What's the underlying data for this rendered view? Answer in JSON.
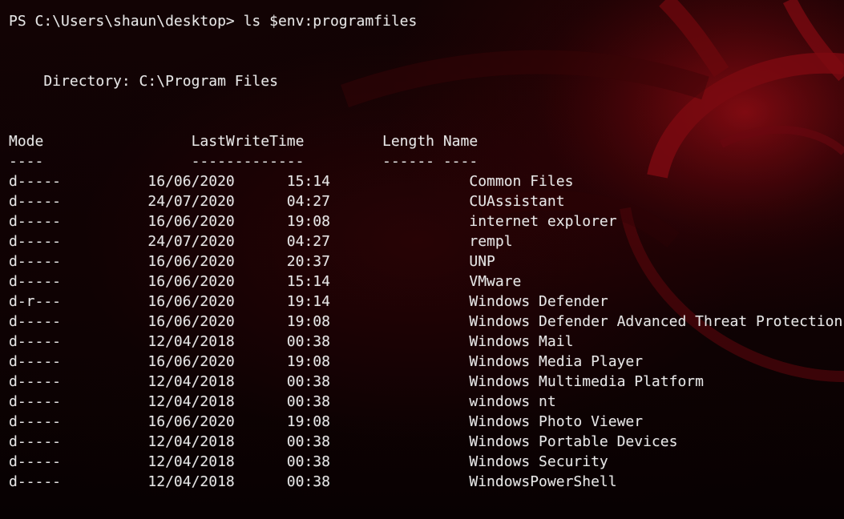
{
  "prompt": {
    "text": "PS C:\\Users\\shaun\\desktop> ls $env:programfiles"
  },
  "directory_line": "    Directory: C:\\Program Files",
  "listing": {
    "header_line": "Mode                 LastWriteTime         Length Name",
    "underline_line": "----                 -------------         ------ ----",
    "columns": [
      "Mode",
      "LastWriteTime",
      "Length",
      "Name"
    ],
    "rows": [
      {
        "mode": "d-----",
        "date": "16/06/2020",
        "time": "15:14",
        "length": "",
        "name": "Common Files"
      },
      {
        "mode": "d-----",
        "date": "24/07/2020",
        "time": "04:27",
        "length": "",
        "name": "CUAssistant"
      },
      {
        "mode": "d-----",
        "date": "16/06/2020",
        "time": "19:08",
        "length": "",
        "name": "internet explorer"
      },
      {
        "mode": "d-----",
        "date": "24/07/2020",
        "time": "04:27",
        "length": "",
        "name": "rempl"
      },
      {
        "mode": "d-----",
        "date": "16/06/2020",
        "time": "20:37",
        "length": "",
        "name": "UNP"
      },
      {
        "mode": "d-----",
        "date": "16/06/2020",
        "time": "15:14",
        "length": "",
        "name": "VMware"
      },
      {
        "mode": "d-r---",
        "date": "16/06/2020",
        "time": "19:14",
        "length": "",
        "name": "Windows Defender"
      },
      {
        "mode": "d-----",
        "date": "16/06/2020",
        "time": "19:08",
        "length": "",
        "name": "Windows Defender Advanced Threat Protection"
      },
      {
        "mode": "d-----",
        "date": "12/04/2018",
        "time": "00:38",
        "length": "",
        "name": "Windows Mail"
      },
      {
        "mode": "d-----",
        "date": "16/06/2020",
        "time": "19:08",
        "length": "",
        "name": "Windows Media Player"
      },
      {
        "mode": "d-----",
        "date": "12/04/2018",
        "time": "00:38",
        "length": "",
        "name": "Windows Multimedia Platform"
      },
      {
        "mode": "d-----",
        "date": "12/04/2018",
        "time": "00:38",
        "length": "",
        "name": "windows nt"
      },
      {
        "mode": "d-----",
        "date": "16/06/2020",
        "time": "19:08",
        "length": "",
        "name": "Windows Photo Viewer"
      },
      {
        "mode": "d-----",
        "date": "12/04/2018",
        "time": "00:38",
        "length": "",
        "name": "Windows Portable Devices"
      },
      {
        "mode": "d-----",
        "date": "12/04/2018",
        "time": "00:38",
        "length": "",
        "name": "Windows Security"
      },
      {
        "mode": "d-----",
        "date": "12/04/2018",
        "time": "00:38",
        "length": "",
        "name": "WindowsPowerShell"
      }
    ]
  },
  "colors": {
    "text": "#e6e6e6",
    "background": "#0e0203",
    "accent": "#8a0610"
  }
}
